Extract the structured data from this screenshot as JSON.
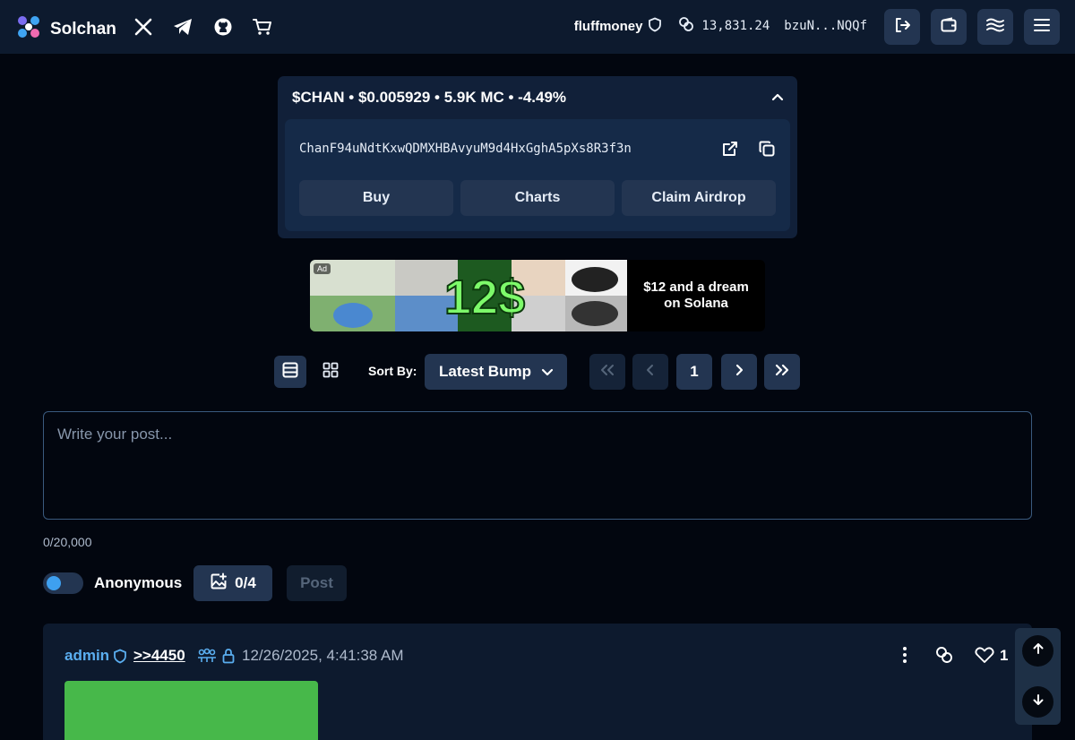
{
  "header": {
    "brand": "Solchan",
    "username": "fluffmoney",
    "balance": "13,831.24",
    "wallet_address": "bzuN...NQQf",
    "icons": [
      "x-icon",
      "telegram-icon",
      "github-icon",
      "cart-icon",
      "logout-icon",
      "wallet-icon",
      "waves-icon",
      "menu-icon"
    ]
  },
  "token": {
    "summary": "$CHAN • $0.005929 • 5.9K MC • -4.49%",
    "contract_address": "ChanF94uNdtKxwQDMXHBAvyuM9d4HxGghA5pXs8R3f3n",
    "buttons": {
      "buy": "Buy",
      "charts": "Charts",
      "airdrop": "Claim Airdrop"
    }
  },
  "ad": {
    "tag": "Ad",
    "text": "$12 and a dream on Solana",
    "art_text": "12$"
  },
  "controls": {
    "sort_label": "Sort By:",
    "sort_value": "Latest Bump",
    "page": "1"
  },
  "composer": {
    "placeholder": "Write your post...",
    "counter": "0/20,000",
    "anonymous_label": "Anonymous",
    "images_count": "0/4",
    "post_label": "Post"
  },
  "thread": {
    "author": "admin",
    "post_id": ">>4450",
    "date": "12/26/2025, 4:41:38 AM",
    "likes": "1"
  },
  "colors": {
    "background": "#02060f",
    "surface": "#0d1a2e",
    "button": "#233551",
    "accent": "#3ea0f0",
    "author": "#5aaef0",
    "thumbnail": "#47b84a"
  }
}
